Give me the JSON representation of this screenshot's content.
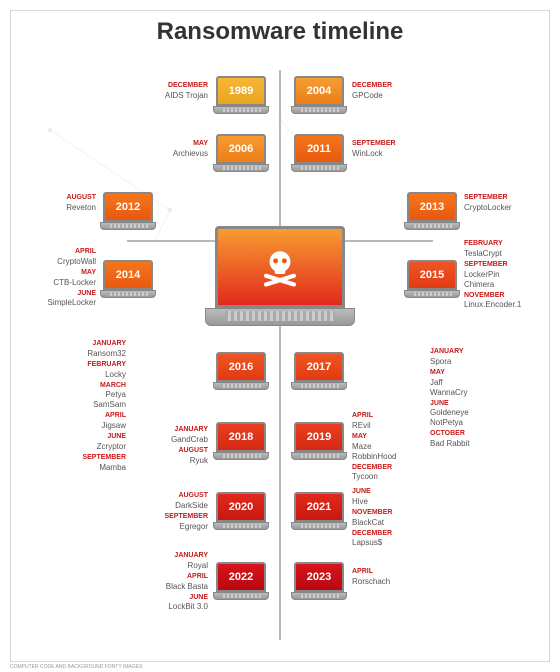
{
  "title": "Ransomware timeline",
  "footer": "COMPUTER CODE AND BACKGROUND FONTY IMAGES",
  "center_icon": "skull-crossbones",
  "years": {
    "y1989": "1989",
    "y2004": "2004",
    "y2006": "2006",
    "y2011": "2011",
    "y2012": "2012",
    "y2013": "2013",
    "y2014": "2014",
    "y2015": "2015",
    "y2016": "2016",
    "y2017": "2017",
    "y2018": "2018",
    "y2019": "2019",
    "y2020": "2020",
    "y2021": "2021",
    "y2022": "2022",
    "y2023": "2023"
  },
  "events": {
    "e1989": [
      {
        "month": "DECEMBER",
        "name": "AIDS Trojan"
      }
    ],
    "e2004": [
      {
        "month": "DECEMBER",
        "name": "GPCode"
      }
    ],
    "e2006": [
      {
        "month": "MAY",
        "name": "Archievus"
      }
    ],
    "e2011": [
      {
        "month": "SEPTEMBER",
        "name": "WinLock"
      }
    ],
    "e2012": [
      {
        "month": "AUGUST",
        "name": "Reveton"
      }
    ],
    "e2013": [
      {
        "month": "SEPTEMBER",
        "name": "CryptoLocker"
      }
    ],
    "e2014": [
      {
        "month": "APRIL",
        "name": "CryptoWall"
      },
      {
        "month": "MAY",
        "name": "CTB-Locker"
      },
      {
        "month": "JUNE",
        "name": "SimpleLocker"
      }
    ],
    "e2015": [
      {
        "month": "FEBRUARY",
        "name": "TeslaCrypt"
      },
      {
        "month": "SEPTEMBER",
        "name": "LockerPin"
      },
      {
        "month": "SEPTEMBER",
        "name": "Chimera"
      },
      {
        "month": "NOVEMBER",
        "name": "Linux.Encoder.1"
      }
    ],
    "e2016": [
      {
        "month": "JANUARY",
        "name": "Ransom32"
      },
      {
        "month": "FEBRUARY",
        "name": "Locky"
      },
      {
        "month": "MARCH",
        "name": "Petya"
      },
      {
        "month": "MARCH",
        "name": "SamSam"
      },
      {
        "month": "APRIL",
        "name": "Jigsaw"
      },
      {
        "month": "JUNE",
        "name": "Zcryptor"
      },
      {
        "month": "SEPTEMBER",
        "name": "Mamba"
      }
    ],
    "e2017": [
      {
        "month": "JANUARY",
        "name": "Spora"
      },
      {
        "month": "MAY",
        "name": "Jaff"
      },
      {
        "month": "MAY",
        "name": "WannaCry"
      },
      {
        "month": "JUNE",
        "name": "Goldeneye"
      },
      {
        "month": "JUNE",
        "name": "NotPetya"
      },
      {
        "month": "OCTOBER",
        "name": "Bad Rabbit"
      }
    ],
    "e2018": [
      {
        "month": "JANUARY",
        "name": "GandCrab"
      },
      {
        "month": "AUGUST",
        "name": "Ryuk"
      }
    ],
    "e2019": [
      {
        "month": "APRIL",
        "name": "REvil"
      },
      {
        "month": "MAY",
        "name": "Maze"
      },
      {
        "month": "MAY",
        "name": "RobbinHood"
      },
      {
        "month": "DECEMBER",
        "name": "Tycoon"
      }
    ],
    "e2020": [
      {
        "month": "AUGUST",
        "name": "DarkSide"
      },
      {
        "month": "SEPTEMBER",
        "name": "Egregor"
      }
    ],
    "e2021": [
      {
        "month": "JUNE",
        "name": "Hive"
      },
      {
        "month": "NOVEMBER",
        "name": "BlackCat"
      },
      {
        "month": "DECEMBER",
        "name": "Lapsus$"
      }
    ],
    "e2022": [
      {
        "month": "JANUARY",
        "name": "Royal"
      },
      {
        "month": "APRIL",
        "name": "Black Basta"
      },
      {
        "month": "JUNE",
        "name": "LockBit 3.0"
      }
    ],
    "e2023": [
      {
        "month": "APRIL",
        "name": "Rorschach"
      }
    ]
  }
}
